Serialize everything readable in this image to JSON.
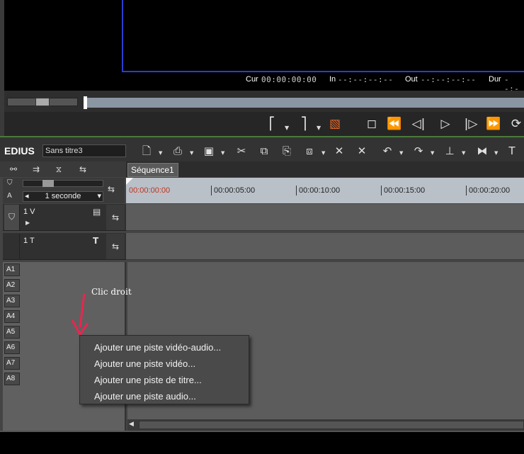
{
  "recorder": {
    "timecodes": [
      {
        "label": "Cur",
        "value": "00:00:00:00"
      },
      {
        "label": "In",
        "value": "--:--:--:--"
      },
      {
        "label": "Out",
        "value": "--:--:--:--"
      },
      {
        "label": "Dur",
        "value": "--:--:--:--"
      }
    ],
    "buttons": [
      {
        "name": "mark-in-icon",
        "glyph": "⎡"
      },
      {
        "name": "mark-out-icon",
        "glyph": "⎤"
      },
      {
        "name": "clear-marks-icon",
        "glyph": "▧"
      },
      {
        "name": "stop-icon",
        "glyph": "◻"
      },
      {
        "name": "rewind-icon",
        "glyph": "⏪"
      },
      {
        "name": "step-back-icon",
        "glyph": "◁|"
      },
      {
        "name": "play-icon",
        "glyph": "▷"
      },
      {
        "name": "step-forward-icon",
        "glyph": "|▷"
      },
      {
        "name": "fast-forward-icon",
        "glyph": "⏩"
      },
      {
        "name": "loop-icon",
        "glyph": "⟳"
      }
    ]
  },
  "timeline": {
    "logo": "EDIUS",
    "project_name": "Sans titre3",
    "sequence_tab": "Séquence1",
    "scale": "1 seconde",
    "ruler_labels": [
      "00:00:00:00",
      "00:00:05:00",
      "00:00:10:00",
      "00:00:15:00",
      "00:00:20:00"
    ],
    "tracks": [
      {
        "name": "1 V",
        "type": "video"
      },
      {
        "name": "1 T",
        "type": "title"
      }
    ],
    "audio_tracks": [
      "1",
      "2",
      "3",
      "4",
      "5",
      "6",
      "7",
      "8"
    ]
  },
  "annotation": {
    "text": "Clic droit"
  },
  "context_menu": {
    "items": [
      "Ajouter une piste vidéo-audio...",
      "Ajouter une piste vidéo...",
      "Ajouter une piste de titre...",
      "Ajouter une piste audio..."
    ]
  },
  "colors": {
    "annotation_arrow": "#e8264f",
    "monitor_border": "#2a3fd0",
    "timecode_start": "#c0331f"
  }
}
